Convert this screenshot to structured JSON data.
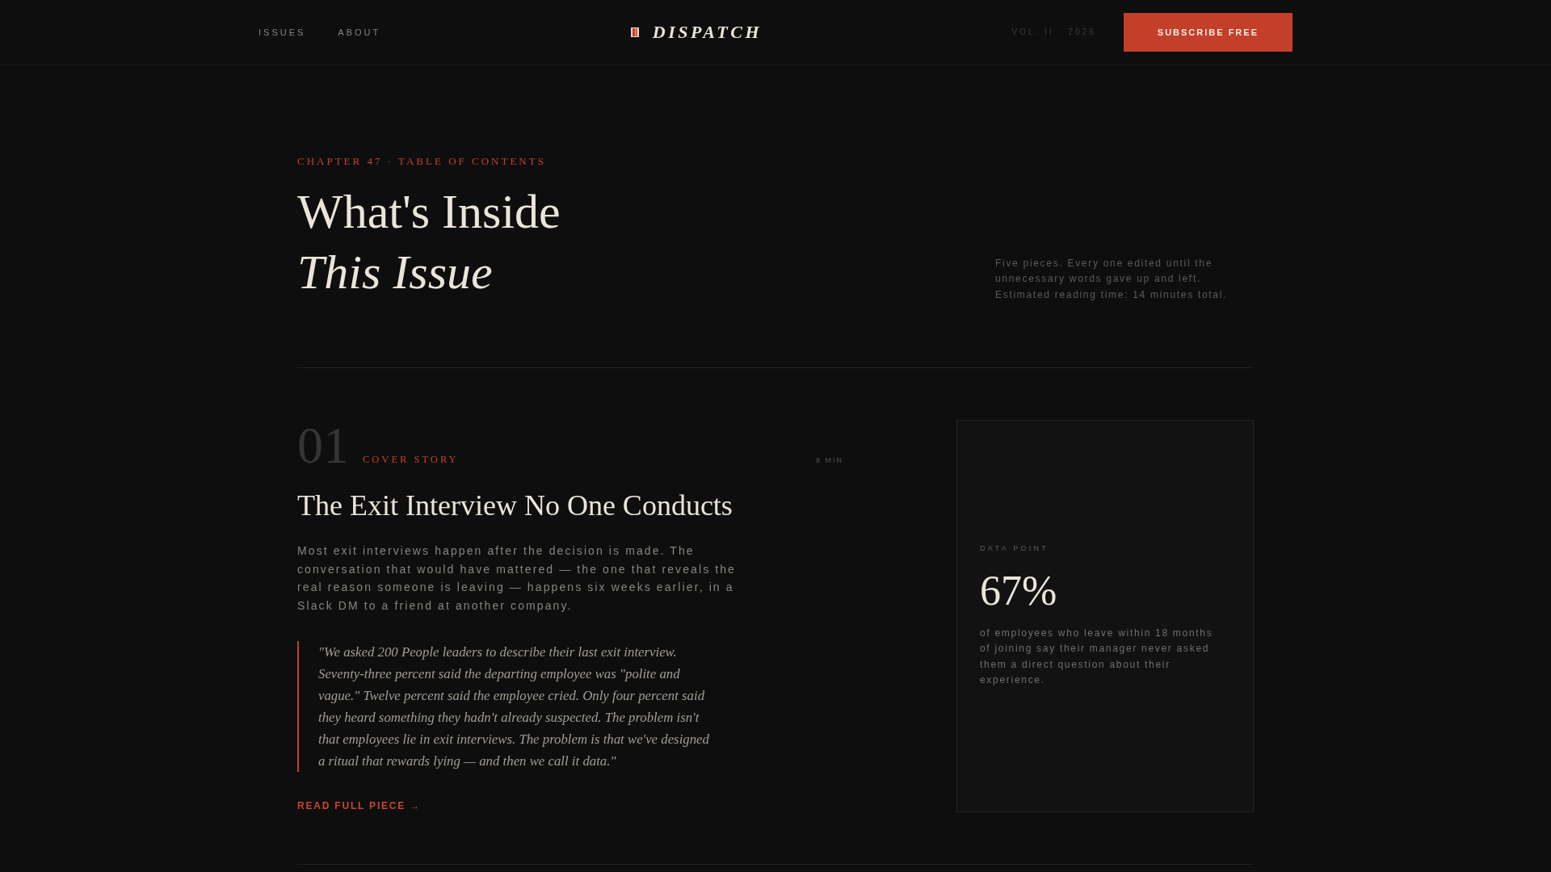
{
  "header": {
    "nav_links": [
      "ISSUES",
      "ABOUT"
    ],
    "logo": "DISPATCH",
    "volume": "VOL. II · 2026",
    "subscribe_button": "SUBSCRIBE FREE"
  },
  "hero": {
    "eyebrow": "CHAPTER 47 · TABLE OF CONTENTS",
    "title": "What's Inside *This Issue*",
    "intro": "Five pieces. Every one edited until the unnecessary words gave up and left. Estimated reading time: 14 minutes total."
  },
  "articles": [
    {
      "number": "01",
      "category": "COVER STORY",
      "read_time": "8 MIN",
      "title": "The Exit Interview No One Conducts",
      "summary": "Most exit interviews happen after the decision is made. The conversation that would have mattered — the one that reveals the real reason someone is leaving — happens six weeks earlier, in a Slack DM to a friend at another company.",
      "quote": "\"We asked 200 People leaders to describe their last exit interview. Seventy-three percent said the departing employee was \"polite and vague.\" Twelve percent said the employee cried. Only four percent said they heard something they hadn't already suspected. The problem isn't that employees lie in exit interviews. The problem is that we've designed a ritual that rewards lying — and then we call it data.\"",
      "link": "READ FULL PIECE →",
      "data_point": {
        "label": "DATA POINT",
        "value": "67%",
        "caption": "of employees who leave within 18 months of joining say their manager never asked them a direct question about their experience."
      }
    }
  ]
}
